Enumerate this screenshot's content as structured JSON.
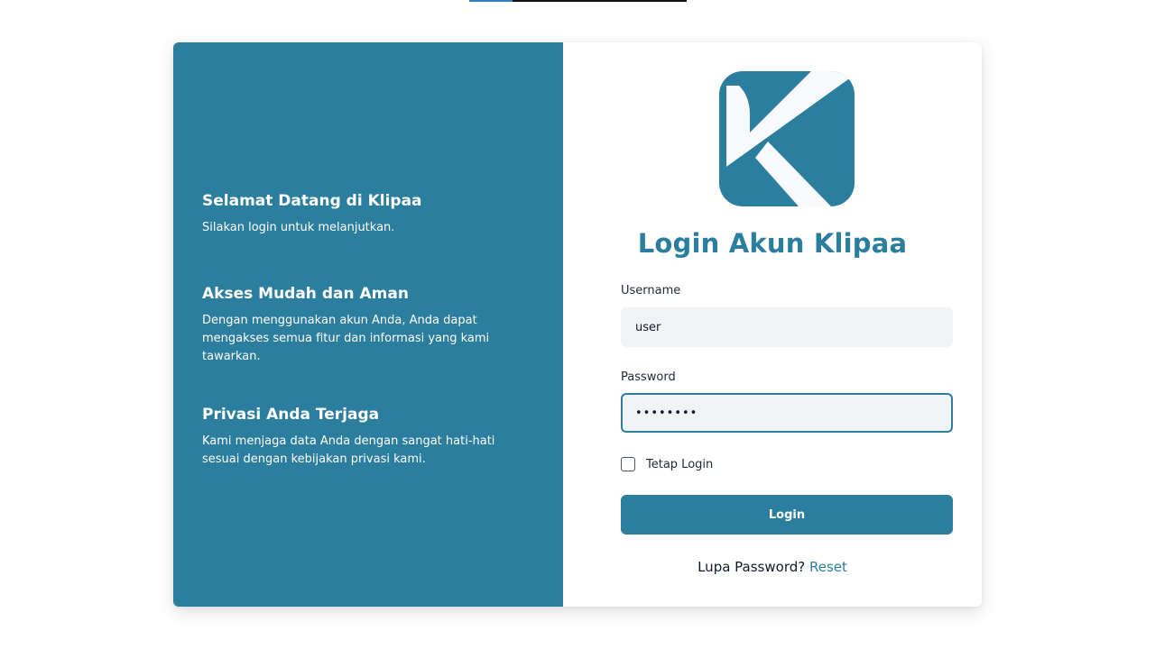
{
  "top_progress": {
    "fill_fraction": 0.2,
    "fill_color": "#2b7fc4"
  },
  "brand": {
    "primary_color": "#2c7e9e",
    "logo_icon": "klipaa-k-logo-icon"
  },
  "left_panel": {
    "features": [
      {
        "title": "Selamat Datang di Klipaa",
        "text": "Silakan login untuk melanjutkan."
      },
      {
        "title": "Akses Mudah dan Aman",
        "text": "Dengan menggunakan akun Anda, Anda dapat mengakses semua fitur dan informasi yang kami tawarkan."
      },
      {
        "title": "Privasi Anda Terjaga",
        "text": "Kami menjaga data Anda dengan sangat hati-hati sesuai dengan kebijakan privasi kami."
      }
    ]
  },
  "login_form": {
    "title": "Login Akun Klipaa",
    "username_label": "Username",
    "username_value": "user",
    "password_label": "Password",
    "password_value": "••••••••",
    "remember_label": "Tetap Login",
    "remember_checked": false,
    "submit_label": "Login",
    "forgot_text": "Lupa Password?",
    "reset_link": "Reset"
  }
}
